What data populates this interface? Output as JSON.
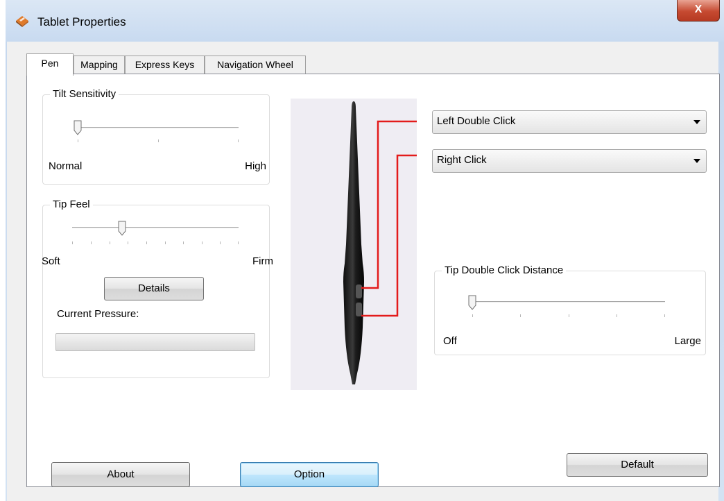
{
  "window": {
    "title": "Tablet Properties",
    "close_label": "X"
  },
  "tabs": [
    {
      "label": "Pen"
    },
    {
      "label": "Mapping"
    },
    {
      "label": "Express Keys"
    },
    {
      "label": "Navigation Wheel"
    }
  ],
  "tilt": {
    "legend": "Tilt Sensitivity",
    "min_label": "Normal",
    "max_label": "High",
    "level": 0
  },
  "tip_feel": {
    "legend": "Tip Feel",
    "min_label": "Soft",
    "max_label": "Firm",
    "level": 0.3,
    "details_label": "Details",
    "pressure_label": "Current Pressure:",
    "pressure_value": 0
  },
  "pen_buttons": {
    "upper": "Left Double Click",
    "lower": "Right Click"
  },
  "double_click_distance": {
    "legend": "Tip Double Click Distance",
    "min_label": "Off",
    "max_label": "Large",
    "level": 0
  },
  "buttons": {
    "default_label": "Default",
    "about_label": "About",
    "option_label": "Option"
  },
  "icons": {
    "app": "tablet-app-icon",
    "close": "close-icon",
    "dropdown": "chevron-down-icon"
  },
  "colors": {
    "leader_lines": "#e31b1b",
    "focus_button": "#bee6fd",
    "close_button": "#c64a31"
  }
}
